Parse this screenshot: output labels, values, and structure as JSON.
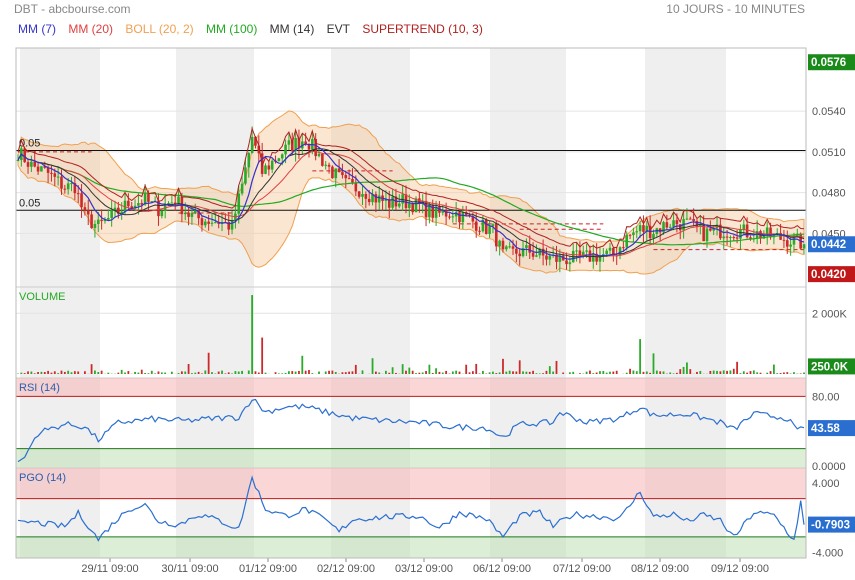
{
  "header": {
    "left": "DBT - abcbourse.com",
    "right": "10 JOURS - 10 MINUTES"
  },
  "legend": [
    {
      "label": "MM (7)",
      "color": "#3333cc"
    },
    {
      "label": "MM (20)",
      "color": "#e04040"
    },
    {
      "label": "BOLL (20, 2)",
      "color": "#f0a050"
    },
    {
      "label": "MM (100)",
      "color": "#22aa22"
    },
    {
      "label": "MM (14)",
      "color": "#333333"
    },
    {
      "label": "EVT",
      "color": "#333333"
    },
    {
      "label": "SUPERTREND (10, 3)",
      "color": "#b02020"
    }
  ],
  "chart_data": [
    {
      "type": "candlestick",
      "x_tick_labels": [
        "29/11 09:00",
        "30/11 09:00",
        "01/12 09:00",
        "02/12 09:00",
        "03/12 09:00",
        "06/12 09:00",
        "07/12 09:00",
        "08/12 09:00",
        "09/12 09:00"
      ],
      "y_tick_labels": [
        "0.0540",
        "0.0510",
        "0.0480",
        "0.0450"
      ],
      "ylim": [
        0.0412,
        0.0585
      ],
      "badges": [
        {
          "label": "0.0576",
          "value": 0.0576,
          "color": "#1a8a1a"
        },
        {
          "label": "0.0442",
          "value": 0.0442,
          "color": "#2a6fd0"
        },
        {
          "label": "0.0420",
          "value": 0.042,
          "color": "#c01818"
        }
      ],
      "line_labels": [
        {
          "label": "0.05",
          "value": 0.0511
        },
        {
          "label": "0.05",
          "value": 0.0467
        }
      ],
      "price_path": [
        [
          0,
          0.051
        ],
        [
          4,
          0.05
        ],
        [
          9,
          0.0494
        ],
        [
          14,
          0.0484
        ],
        [
          17,
          0.0485
        ],
        [
          20,
          0.0462
        ],
        [
          24,
          0.0455
        ],
        [
          29,
          0.0464
        ],
        [
          33,
          0.0472
        ],
        [
          38,
          0.0474
        ],
        [
          42,
          0.0468
        ],
        [
          47,
          0.0475
        ],
        [
          51,
          0.0464
        ],
        [
          55,
          0.046
        ],
        [
          60,
          0.0459
        ],
        [
          64,
          0.0455
        ],
        [
          67,
          0.0485
        ],
        [
          70,
          0.0521
        ],
        [
          73,
          0.0495
        ],
        [
          77,
          0.0505
        ],
        [
          81,
          0.0514
        ],
        [
          86,
          0.052
        ],
        [
          90,
          0.0507
        ],
        [
          94,
          0.0495
        ],
        [
          98,
          0.0486
        ],
        [
          103,
          0.0482
        ],
        [
          107,
          0.0476
        ],
        [
          111,
          0.0472
        ],
        [
          115,
          0.0474
        ],
        [
          120,
          0.047
        ],
        [
          125,
          0.0464
        ],
        [
          130,
          0.0466
        ],
        [
          135,
          0.046
        ],
        [
          139,
          0.0455
        ],
        [
          142,
          0.0452
        ],
        [
          145,
          0.0434
        ],
        [
          149,
          0.0436
        ],
        [
          153,
          0.0437
        ],
        [
          157,
          0.0433
        ],
        [
          161,
          0.0431
        ],
        [
          165,
          0.0431
        ],
        [
          169,
          0.0432
        ],
        [
          174,
          0.0434
        ],
        [
          178,
          0.0434
        ],
        [
          182,
          0.0447
        ],
        [
          186,
          0.0453
        ],
        [
          190,
          0.0452
        ],
        [
          195,
          0.0458
        ],
        [
          200,
          0.0457
        ],
        [
          205,
          0.045
        ],
        [
          210,
          0.0452
        ],
        [
          215,
          0.0452
        ],
        [
          220,
          0.045
        ],
        [
          225,
          0.0448
        ],
        [
          233,
          0.0444
        ],
        [
          235,
          0.0442
        ]
      ]
    },
    {
      "type": "bar",
      "title": "VOLUME",
      "y_tick_labels": [
        "2 000K"
      ],
      "ylim": [
        0,
        2800
      ],
      "badges": [
        {
          "label": "250.0K",
          "value": 250,
          "color": "#1a8a1a"
        }
      ],
      "spikes": [
        [
          70,
          2600
        ],
        [
          73,
          1200
        ],
        [
          57,
          700
        ],
        [
          85,
          600
        ],
        [
          106,
          520
        ],
        [
          145,
          500
        ],
        [
          150,
          450
        ],
        [
          161,
          430
        ],
        [
          186,
          1150
        ],
        [
          190,
          680
        ],
        [
          200,
          380
        ],
        [
          215,
          400
        ]
      ]
    },
    {
      "type": "line",
      "title": "RSI (14)",
      "y_tick_labels": [
        "80.00",
        "0.0000"
      ],
      "ylim": [
        0,
        100
      ],
      "bands": [
        80,
        20
      ],
      "badges": [
        {
          "label": "43.58",
          "value": 43.58,
          "color": "#2a6fd0"
        }
      ],
      "path": [
        [
          0,
          5
        ],
        [
          2,
          10
        ],
        [
          4,
          25
        ],
        [
          6,
          38
        ],
        [
          9,
          42
        ],
        [
          14,
          48
        ],
        [
          20,
          45
        ],
        [
          24,
          30
        ],
        [
          30,
          50
        ],
        [
          40,
          54
        ],
        [
          50,
          52
        ],
        [
          60,
          55
        ],
        [
          66,
          56
        ],
        [
          70,
          78
        ],
        [
          74,
          62
        ],
        [
          80,
          68
        ],
        [
          86,
          68
        ],
        [
          92,
          62
        ],
        [
          100,
          55
        ],
        [
          110,
          52
        ],
        [
          120,
          50
        ],
        [
          130,
          45
        ],
        [
          140,
          44
        ],
        [
          145,
          33
        ],
        [
          150,
          48
        ],
        [
          160,
          50
        ],
        [
          162,
          62
        ],
        [
          170,
          50
        ],
        [
          180,
          55
        ],
        [
          186,
          68
        ],
        [
          190,
          58
        ],
        [
          200,
          60
        ],
        [
          210,
          50
        ],
        [
          214,
          42
        ],
        [
          220,
          60
        ],
        [
          230,
          55
        ],
        [
          233,
          40
        ],
        [
          235,
          44
        ]
      ]
    },
    {
      "type": "line",
      "title": "PGO (14)",
      "y_tick_labels": [
        "4.000",
        "-4.000"
      ],
      "ylim": [
        -4.4,
        5.6
      ],
      "bands": [
        2.2,
        -2.2
      ],
      "badges": [
        {
          "label": "-0.7903",
          "value": -0.7903,
          "color": "#2a6fd0"
        }
      ],
      "path": [
        [
          0,
          -0.3
        ],
        [
          6,
          -0.6
        ],
        [
          10,
          -0.8
        ],
        [
          14,
          -1.0
        ],
        [
          18,
          0.5
        ],
        [
          20,
          -0.4
        ],
        [
          24,
          -2.5
        ],
        [
          28,
          -0.8
        ],
        [
          33,
          1.0
        ],
        [
          38,
          1.5
        ],
        [
          42,
          -0.4
        ],
        [
          48,
          -0.8
        ],
        [
          54,
          0.4
        ],
        [
          60,
          -0.3
        ],
        [
          66,
          -1.3
        ],
        [
          70,
          4.6
        ],
        [
          74,
          1.0
        ],
        [
          80,
          0.2
        ],
        [
          86,
          1.0
        ],
        [
          92,
          -0.3
        ],
        [
          96,
          -1.6
        ],
        [
          100,
          -0.2
        ],
        [
          110,
          0.1
        ],
        [
          120,
          0.2
        ],
        [
          126,
          -1.2
        ],
        [
          132,
          0.6
        ],
        [
          140,
          -0.1
        ],
        [
          145,
          -2.2
        ],
        [
          150,
          0.2
        ],
        [
          156,
          0.6
        ],
        [
          160,
          -1.0
        ],
        [
          166,
          0.4
        ],
        [
          172,
          0.2
        ],
        [
          180,
          -0.1
        ],
        [
          186,
          3.0
        ],
        [
          190,
          0.1
        ],
        [
          196,
          0.4
        ],
        [
          200,
          -0.4
        ],
        [
          205,
          0.3
        ],
        [
          210,
          -0.3
        ],
        [
          214,
          -2.3
        ],
        [
          220,
          0.6
        ],
        [
          226,
          0.3
        ],
        [
          232,
          -2.6
        ],
        [
          234,
          1.8
        ],
        [
          235,
          -0.8
        ]
      ]
    }
  ]
}
